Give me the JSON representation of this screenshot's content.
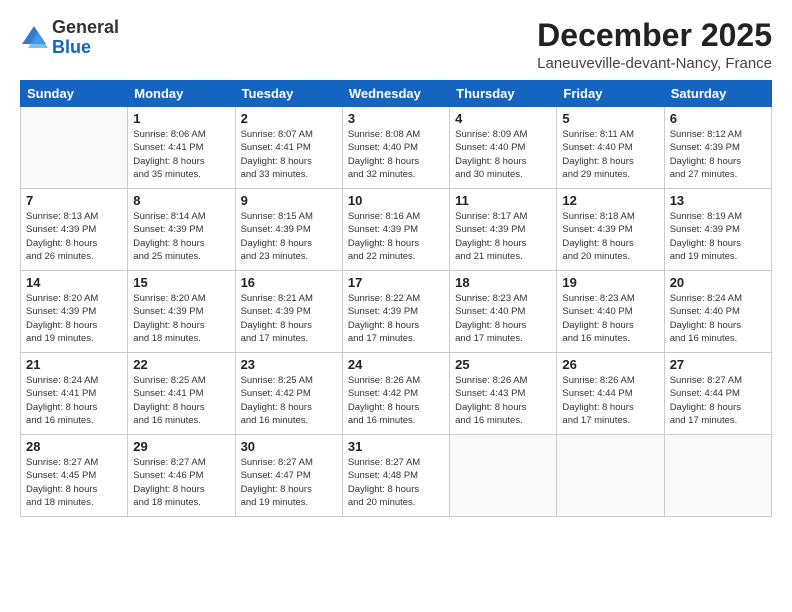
{
  "logo": {
    "general": "General",
    "blue": "Blue"
  },
  "header": {
    "month_year": "December 2025",
    "location": "Laneuveville-devant-Nancy, France"
  },
  "days_of_week": [
    "Sunday",
    "Monday",
    "Tuesday",
    "Wednesday",
    "Thursday",
    "Friday",
    "Saturday"
  ],
  "weeks": [
    [
      {
        "day": "",
        "sunrise": "",
        "sunset": "",
        "daylight": ""
      },
      {
        "day": "1",
        "sunrise": "Sunrise: 8:06 AM",
        "sunset": "Sunset: 4:41 PM",
        "daylight": "Daylight: 8 hours and 35 minutes."
      },
      {
        "day": "2",
        "sunrise": "Sunrise: 8:07 AM",
        "sunset": "Sunset: 4:41 PM",
        "daylight": "Daylight: 8 hours and 33 minutes."
      },
      {
        "day": "3",
        "sunrise": "Sunrise: 8:08 AM",
        "sunset": "Sunset: 4:40 PM",
        "daylight": "Daylight: 8 hours and 32 minutes."
      },
      {
        "day": "4",
        "sunrise": "Sunrise: 8:09 AM",
        "sunset": "Sunset: 4:40 PM",
        "daylight": "Daylight: 8 hours and 30 minutes."
      },
      {
        "day": "5",
        "sunrise": "Sunrise: 8:11 AM",
        "sunset": "Sunset: 4:40 PM",
        "daylight": "Daylight: 8 hours and 29 minutes."
      },
      {
        "day": "6",
        "sunrise": "Sunrise: 8:12 AM",
        "sunset": "Sunset: 4:39 PM",
        "daylight": "Daylight: 8 hours and 27 minutes."
      }
    ],
    [
      {
        "day": "7",
        "sunrise": "Sunrise: 8:13 AM",
        "sunset": "Sunset: 4:39 PM",
        "daylight": "Daylight: 8 hours and 26 minutes."
      },
      {
        "day": "8",
        "sunrise": "Sunrise: 8:14 AM",
        "sunset": "Sunset: 4:39 PM",
        "daylight": "Daylight: 8 hours and 25 minutes."
      },
      {
        "day": "9",
        "sunrise": "Sunrise: 8:15 AM",
        "sunset": "Sunset: 4:39 PM",
        "daylight": "Daylight: 8 hours and 23 minutes."
      },
      {
        "day": "10",
        "sunrise": "Sunrise: 8:16 AM",
        "sunset": "Sunset: 4:39 PM",
        "daylight": "Daylight: 8 hours and 22 minutes."
      },
      {
        "day": "11",
        "sunrise": "Sunrise: 8:17 AM",
        "sunset": "Sunset: 4:39 PM",
        "daylight": "Daylight: 8 hours and 21 minutes."
      },
      {
        "day": "12",
        "sunrise": "Sunrise: 8:18 AM",
        "sunset": "Sunset: 4:39 PM",
        "daylight": "Daylight: 8 hours and 20 minutes."
      },
      {
        "day": "13",
        "sunrise": "Sunrise: 8:19 AM",
        "sunset": "Sunset: 4:39 PM",
        "daylight": "Daylight: 8 hours and 19 minutes."
      }
    ],
    [
      {
        "day": "14",
        "sunrise": "Sunrise: 8:20 AM",
        "sunset": "Sunset: 4:39 PM",
        "daylight": "Daylight: 8 hours and 19 minutes."
      },
      {
        "day": "15",
        "sunrise": "Sunrise: 8:20 AM",
        "sunset": "Sunset: 4:39 PM",
        "daylight": "Daylight: 8 hours and 18 minutes."
      },
      {
        "day": "16",
        "sunrise": "Sunrise: 8:21 AM",
        "sunset": "Sunset: 4:39 PM",
        "daylight": "Daylight: 8 hours and 17 minutes."
      },
      {
        "day": "17",
        "sunrise": "Sunrise: 8:22 AM",
        "sunset": "Sunset: 4:39 PM",
        "daylight": "Daylight: 8 hours and 17 minutes."
      },
      {
        "day": "18",
        "sunrise": "Sunrise: 8:23 AM",
        "sunset": "Sunset: 4:40 PM",
        "daylight": "Daylight: 8 hours and 17 minutes."
      },
      {
        "day": "19",
        "sunrise": "Sunrise: 8:23 AM",
        "sunset": "Sunset: 4:40 PM",
        "daylight": "Daylight: 8 hours and 16 minutes."
      },
      {
        "day": "20",
        "sunrise": "Sunrise: 8:24 AM",
        "sunset": "Sunset: 4:40 PM",
        "daylight": "Daylight: 8 hours and 16 minutes."
      }
    ],
    [
      {
        "day": "21",
        "sunrise": "Sunrise: 8:24 AM",
        "sunset": "Sunset: 4:41 PM",
        "daylight": "Daylight: 8 hours and 16 minutes."
      },
      {
        "day": "22",
        "sunrise": "Sunrise: 8:25 AM",
        "sunset": "Sunset: 4:41 PM",
        "daylight": "Daylight: 8 hours and 16 minutes."
      },
      {
        "day": "23",
        "sunrise": "Sunrise: 8:25 AM",
        "sunset": "Sunset: 4:42 PM",
        "daylight": "Daylight: 8 hours and 16 minutes."
      },
      {
        "day": "24",
        "sunrise": "Sunrise: 8:26 AM",
        "sunset": "Sunset: 4:42 PM",
        "daylight": "Daylight: 8 hours and 16 minutes."
      },
      {
        "day": "25",
        "sunrise": "Sunrise: 8:26 AM",
        "sunset": "Sunset: 4:43 PM",
        "daylight": "Daylight: 8 hours and 16 minutes."
      },
      {
        "day": "26",
        "sunrise": "Sunrise: 8:26 AM",
        "sunset": "Sunset: 4:44 PM",
        "daylight": "Daylight: 8 hours and 17 minutes."
      },
      {
        "day": "27",
        "sunrise": "Sunrise: 8:27 AM",
        "sunset": "Sunset: 4:44 PM",
        "daylight": "Daylight: 8 hours and 17 minutes."
      }
    ],
    [
      {
        "day": "28",
        "sunrise": "Sunrise: 8:27 AM",
        "sunset": "Sunset: 4:45 PM",
        "daylight": "Daylight: 8 hours and 18 minutes."
      },
      {
        "day": "29",
        "sunrise": "Sunrise: 8:27 AM",
        "sunset": "Sunset: 4:46 PM",
        "daylight": "Daylight: 8 hours and 18 minutes."
      },
      {
        "day": "30",
        "sunrise": "Sunrise: 8:27 AM",
        "sunset": "Sunset: 4:47 PM",
        "daylight": "Daylight: 8 hours and 19 minutes."
      },
      {
        "day": "31",
        "sunrise": "Sunrise: 8:27 AM",
        "sunset": "Sunset: 4:48 PM",
        "daylight": "Daylight: 8 hours and 20 minutes."
      },
      {
        "day": "",
        "sunrise": "",
        "sunset": "",
        "daylight": ""
      },
      {
        "day": "",
        "sunrise": "",
        "sunset": "",
        "daylight": ""
      },
      {
        "day": "",
        "sunrise": "",
        "sunset": "",
        "daylight": ""
      }
    ]
  ]
}
